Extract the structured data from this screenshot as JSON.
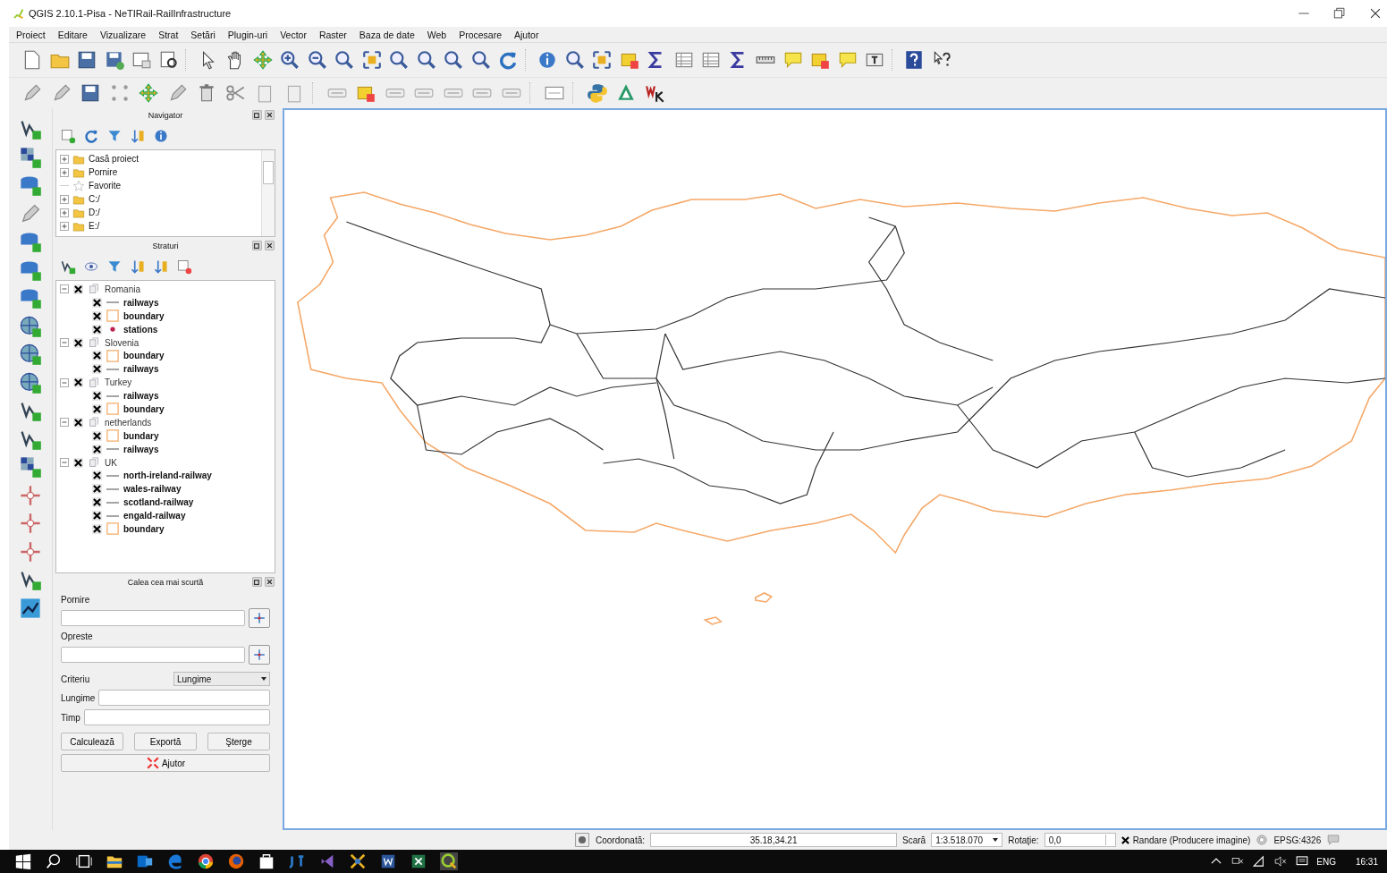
{
  "window": {
    "title": "QGIS 2.10.1-Pisa - NeTIRail-RailInfrastructure"
  },
  "menu": [
    "Proiect",
    "Editare",
    "Vizualizare",
    "Strat",
    "Setări",
    "Plugin-uri",
    "Vector",
    "Raster",
    "Baza de date",
    "Web",
    "Procesare",
    "Ajutor"
  ],
  "navigator": {
    "title": "Navigator",
    "items": [
      {
        "label": "Casă proiect",
        "kind": "folder",
        "expandable": true
      },
      {
        "label": "Pornire",
        "kind": "folder",
        "expandable": true
      },
      {
        "label": "Favorite",
        "kind": "star",
        "expandable": false
      },
      {
        "label": "C:/",
        "kind": "folder",
        "expandable": true
      },
      {
        "label": "D:/",
        "kind": "folder",
        "expandable": true
      },
      {
        "label": "E:/",
        "kind": "folder",
        "expandable": true
      }
    ]
  },
  "layers": {
    "title": "Straturi",
    "groups": [
      {
        "label": "Romania",
        "checked": true,
        "expanded": true,
        "children": [
          {
            "label": "railways",
            "kind": "line",
            "checked": true
          },
          {
            "label": "boundary",
            "kind": "polygon",
            "checked": true
          },
          {
            "label": "stations",
            "kind": "point",
            "checked": true
          }
        ]
      },
      {
        "label": "Slovenia",
        "checked": true,
        "expanded": true,
        "children": [
          {
            "label": "boundary",
            "kind": "polygon",
            "checked": true
          },
          {
            "label": "railways",
            "kind": "line",
            "checked": true
          }
        ]
      },
      {
        "label": "Turkey",
        "checked": true,
        "expanded": true,
        "children": [
          {
            "label": "railways",
            "kind": "line",
            "checked": true
          },
          {
            "label": "boundary",
            "kind": "polygon",
            "checked": true
          }
        ]
      },
      {
        "label": "netherlands",
        "checked": true,
        "expanded": true,
        "children": [
          {
            "label": "bundary",
            "kind": "polygon",
            "checked": true
          },
          {
            "label": "railways",
            "kind": "line",
            "checked": true
          }
        ]
      },
      {
        "label": "UK",
        "checked": true,
        "expanded": true,
        "children": [
          {
            "label": "north-ireland-railway",
            "kind": "line",
            "checked": true
          },
          {
            "label": "wales-railway",
            "kind": "line",
            "checked": true
          },
          {
            "label": "scotland-railway",
            "kind": "line",
            "checked": true
          },
          {
            "label": "engald-railway",
            "kind": "line",
            "checked": true
          },
          {
            "label": "boundary",
            "kind": "polygon",
            "checked": true
          }
        ]
      }
    ]
  },
  "shortest_path": {
    "title": "Calea cea mai scurtă",
    "start_label": "Pornire",
    "stop_label": "Opreste",
    "criterion_label": "Criteriu",
    "criterion_value": "Lungime",
    "length_label": "Lungime",
    "time_label": "Timp",
    "buttons": [
      "Calculează",
      "Exportă",
      "Şterge"
    ],
    "help_button": "Ajutor"
  },
  "status_bar": {
    "coordinate_label": "Coordonată:",
    "coordinate_value": "35.18,34.21",
    "scale_label": "Scară",
    "scale_value": "1:3.518.070",
    "rotation_label": "Rotaţie:",
    "rotation_value": "0,0",
    "render_label": "Randare (Producere imagine)",
    "render_checked": true,
    "crs": "EPSG:4326"
  },
  "taskbar": {
    "language": "ENG",
    "time": "16:31"
  }
}
